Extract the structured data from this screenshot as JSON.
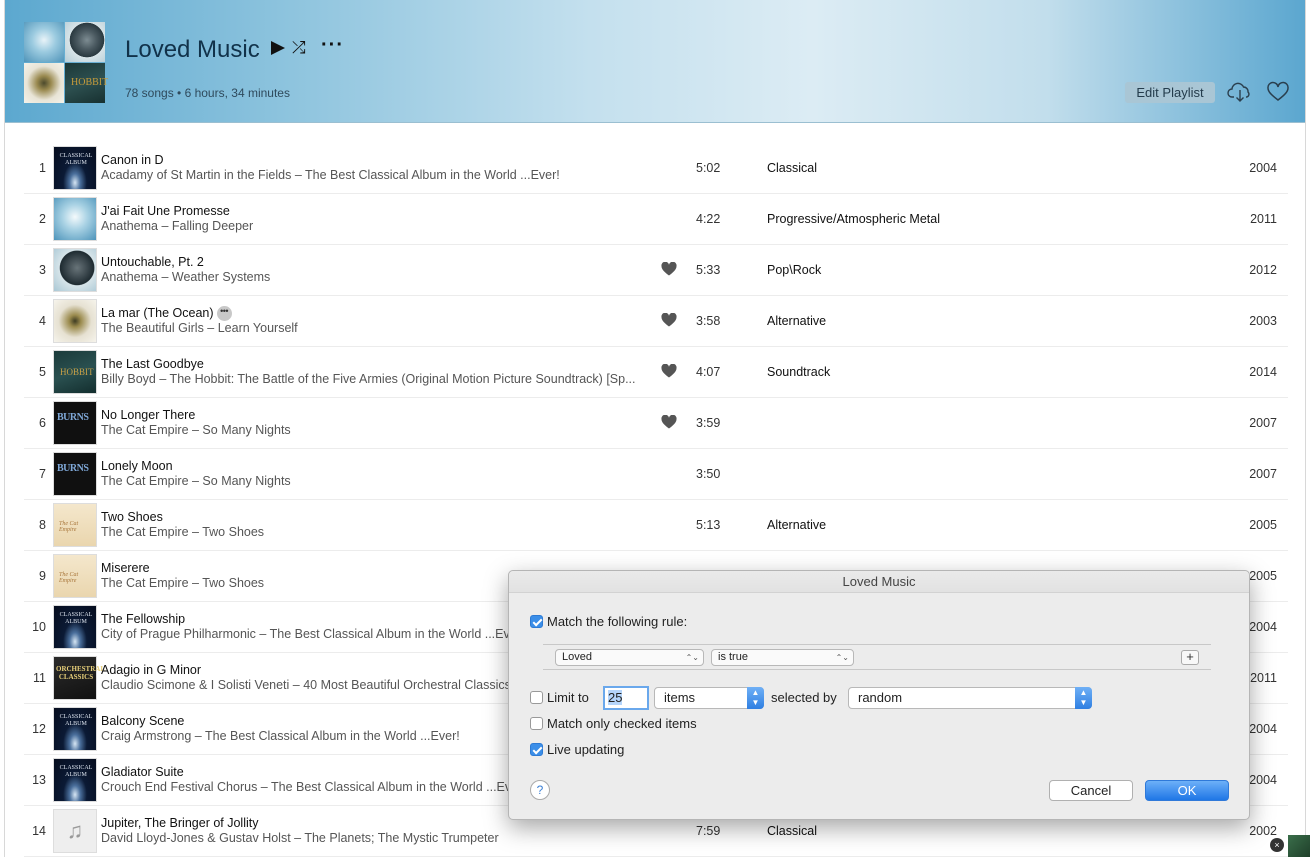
{
  "header": {
    "title": "Loved Music",
    "subtitle": "78 songs • 6 hours, 34 minutes",
    "edit_label": "Edit Playlist",
    "art_hobbit_text": "HOBBIT",
    "icons": {
      "play": "play-icon",
      "shuffle": "shuffle-icon",
      "more": "more-icon",
      "cloud": "cloud-download-icon",
      "heart": "heart-outline-icon"
    }
  },
  "tracks": [
    {
      "num": "1",
      "title": "Canon in D",
      "artist": "Acadamy of St Martin in the Fields – The Best Classical Album in the World ...Ever!",
      "duration": "5:02",
      "genre": "Classical",
      "year": "2004",
      "loved": false,
      "art": "classical"
    },
    {
      "num": "2",
      "title": "J'ai Fait Une Promesse",
      "artist": "Anathema – Falling Deeper",
      "duration": "4:22",
      "genre": "Progressive/Atmospheric  Metal",
      "year": "2011",
      "loved": false,
      "art": "anathema1"
    },
    {
      "num": "3",
      "title": "Untouchable, Pt. 2",
      "artist": "Anathema – Weather Systems",
      "duration": "5:33",
      "genre": "Pop\\Rock",
      "year": "2012",
      "loved": true,
      "art": "anathema2"
    },
    {
      "num": "4",
      "title": "La mar (The Ocean)",
      "artist": "The Beautiful Girls – Learn Yourself",
      "duration": "3:58",
      "genre": "Alternative",
      "year": "2003",
      "loved": true,
      "art": "beautiful",
      "more": "•••"
    },
    {
      "num": "5",
      "title": "The Last Goodbye",
      "artist": "Billy Boyd – The Hobbit: The Battle of the Five Armies (Original Motion Picture Soundtrack) [Sp...",
      "duration": "4:07",
      "genre": "Soundtrack",
      "year": "2014",
      "loved": true,
      "art": "hobbit"
    },
    {
      "num": "6",
      "title": "No Longer There",
      "artist": "The Cat Empire – So Many Nights",
      "duration": "3:59",
      "genre": "",
      "year": "2007",
      "loved": true,
      "art": "burns"
    },
    {
      "num": "7",
      "title": "Lonely Moon",
      "artist": "The Cat Empire – So Many Nights",
      "duration": "3:50",
      "genre": "",
      "year": "2007",
      "loved": false,
      "art": "burns"
    },
    {
      "num": "8",
      "title": "Two Shoes",
      "artist": "The Cat Empire – Two Shoes",
      "duration": "5:13",
      "genre": "Alternative",
      "year": "2005",
      "loved": false,
      "art": "twoshoes"
    },
    {
      "num": "9",
      "title": "Miserere",
      "artist": "The Cat Empire – Two Shoes",
      "duration": "",
      "genre": "",
      "year": "2005",
      "loved": false,
      "art": "twoshoes"
    },
    {
      "num": "10",
      "title": "The Fellowship",
      "artist": "City of Prague Philharmonic – The Best Classical Album in the World ...Ever!",
      "duration": "",
      "genre": "",
      "year": "2004",
      "loved": false,
      "art": "classical"
    },
    {
      "num": "11",
      "title": "Adagio in G Minor",
      "artist": "Claudio Scimone & I Solisti Veneti – 40 Most Beautiful Orchestral Classics",
      "duration": "",
      "genre": "",
      "year": "2011",
      "loved": false,
      "art": "orch"
    },
    {
      "num": "12",
      "title": "Balcony Scene",
      "artist": "Craig Armstrong – The Best Classical Album in the World ...Ever!",
      "duration": "",
      "genre": "",
      "year": "2004",
      "loved": false,
      "art": "classical"
    },
    {
      "num": "13",
      "title": "Gladiator Suite",
      "artist": "Crouch End Festival Chorus – The Best Classical Album in the World ...Ever!",
      "duration": "",
      "genre": "",
      "year": "2004",
      "loved": false,
      "art": "classical"
    },
    {
      "num": "14",
      "title": "Jupiter, The Bringer of Jollity",
      "artist": "David Lloyd-Jones & Gustav Holst – The Planets; The Mystic Trumpeter",
      "duration": "7:59",
      "genre": "Classical",
      "year": "2002",
      "loved": false,
      "art": "note"
    }
  ],
  "art_text": {
    "classical": "CLASSICAL ALBUM",
    "hobbit": "HOBBIT",
    "burns": "BURNS",
    "twoshoes": "The Cat Empire",
    "orch": "ORCHESTRAL CLASSICS",
    "note": "♫"
  },
  "dialog": {
    "title": "Loved Music",
    "match_rule_label": "Match the following rule:",
    "match_rule_checked": true,
    "rule_field": "Loved",
    "rule_operator": "is true",
    "add_rule_symbol": "+",
    "limit_label": "Limit to",
    "limit_checked": false,
    "limit_value": "25",
    "limit_unit": "items",
    "selected_by_label": "selected by",
    "selected_by_value": "random",
    "checked_items_label": "Match only checked items",
    "checked_items_checked": false,
    "live_updating_label": "Live updating",
    "live_updating_checked": true,
    "help_label": "?",
    "cancel_label": "Cancel",
    "ok_label": "OK"
  },
  "corner_close": "×"
}
